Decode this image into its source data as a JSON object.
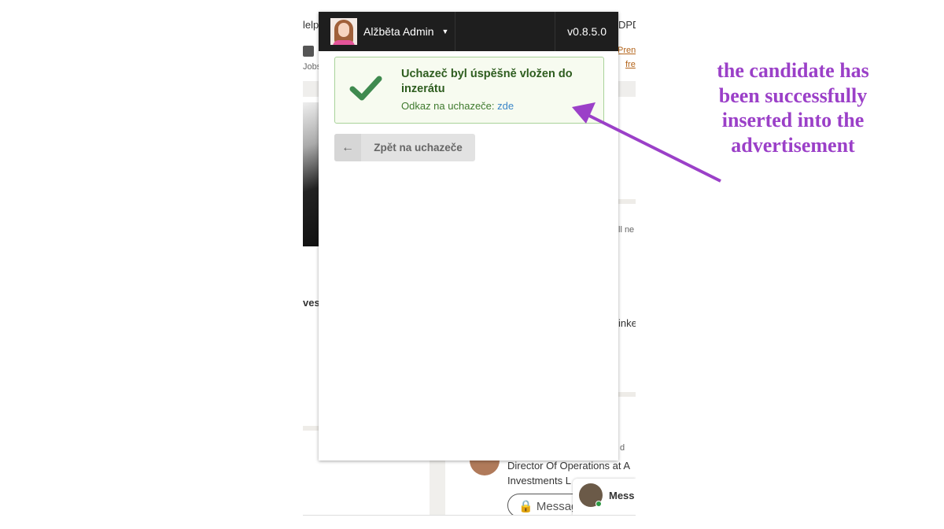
{
  "background": {
    "top_left_text": "lelpe",
    "top_right_text": "DPD",
    "jobs_label": "Jobs",
    "premium_link_1": "Pren",
    "premium_link_2": "fre",
    "left_fragment": "vest",
    "right_fragment_1": "ll ne",
    "right_fragment_2": "inke",
    "right_fragment_3": "d",
    "profile_line_1": "Director Of Operations at A",
    "profile_line_2": "Investments L",
    "message_button": "Messag",
    "messaging_label": "Mess"
  },
  "popup": {
    "user_name": "Alžběta Admin",
    "version": "v0.8.5.0",
    "alert": {
      "title": "Uchazeč byl úspěšně vložen do inzerátu",
      "link_prefix": "Odkaz na uchazeče:",
      "link_label": "zde",
      "icon": "checkmark-icon",
      "color": "#3f8a4f"
    },
    "back_button": "Zpět na uchazeče"
  },
  "annotation": {
    "text": "the candidate has been successfully inserted into the advertisement",
    "color": "#9b40c8"
  }
}
